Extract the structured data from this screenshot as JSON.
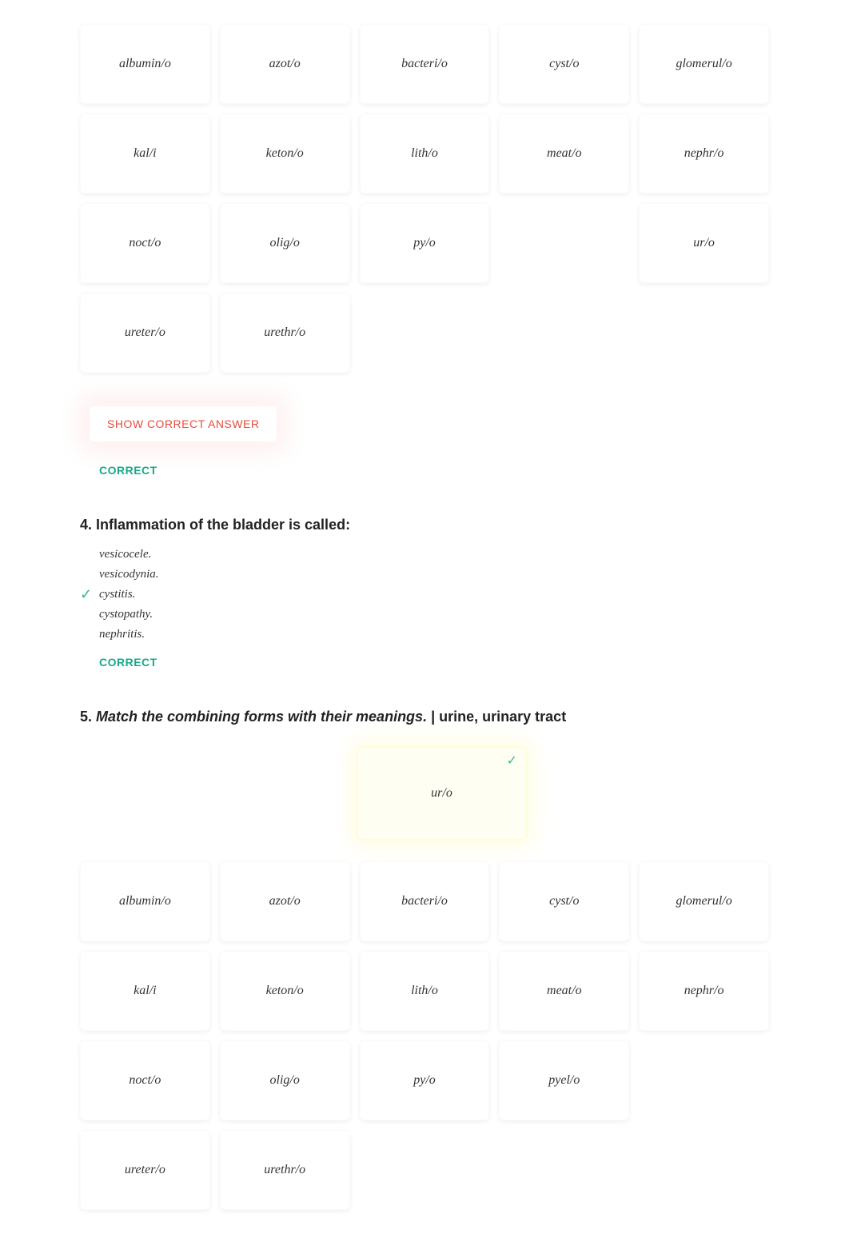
{
  "grid1": {
    "rows": [
      [
        "albumin/o",
        "azot/o",
        "bacteri/o",
        "cyst/o",
        "glomerul/o"
      ],
      [
        "kal/i",
        "keton/o",
        "lith/o",
        "meat/o",
        "nephr/o"
      ],
      [
        "noct/o",
        "olig/o",
        "py/o",
        "",
        "ur/o"
      ],
      [
        "ureter/o",
        "urethr/o",
        "",
        "",
        ""
      ]
    ]
  },
  "showCorrect": "SHOW CORRECT ANSWER",
  "correctLabel": "CORRECT",
  "q4": {
    "heading": "4. Inflammation of the bladder is called:",
    "options": [
      {
        "text": "vesicocele.",
        "checked": false
      },
      {
        "text": "vesicodynia.",
        "checked": false
      },
      {
        "text": "cystitis.",
        "checked": true
      },
      {
        "text": "cystopathy.",
        "checked": false
      },
      {
        "text": "nephritis.",
        "checked": false
      }
    ]
  },
  "q5": {
    "number": "5.",
    "prompt_lead": "Match the combining forms with their meanings.",
    "prompt_tail": "urine, urinary tract",
    "dropped": "ur/o"
  },
  "grid2": {
    "rows": [
      [
        "albumin/o",
        "azot/o",
        "bacteri/o",
        "cyst/o",
        "glomerul/o"
      ],
      [
        "kal/i",
        "keton/o",
        "lith/o",
        "meat/o",
        "nephr/o"
      ],
      [
        "noct/o",
        "olig/o",
        "py/o",
        "pyel/o",
        ""
      ],
      [
        "ureter/o",
        "urethr/o",
        "",
        "",
        ""
      ]
    ]
  }
}
